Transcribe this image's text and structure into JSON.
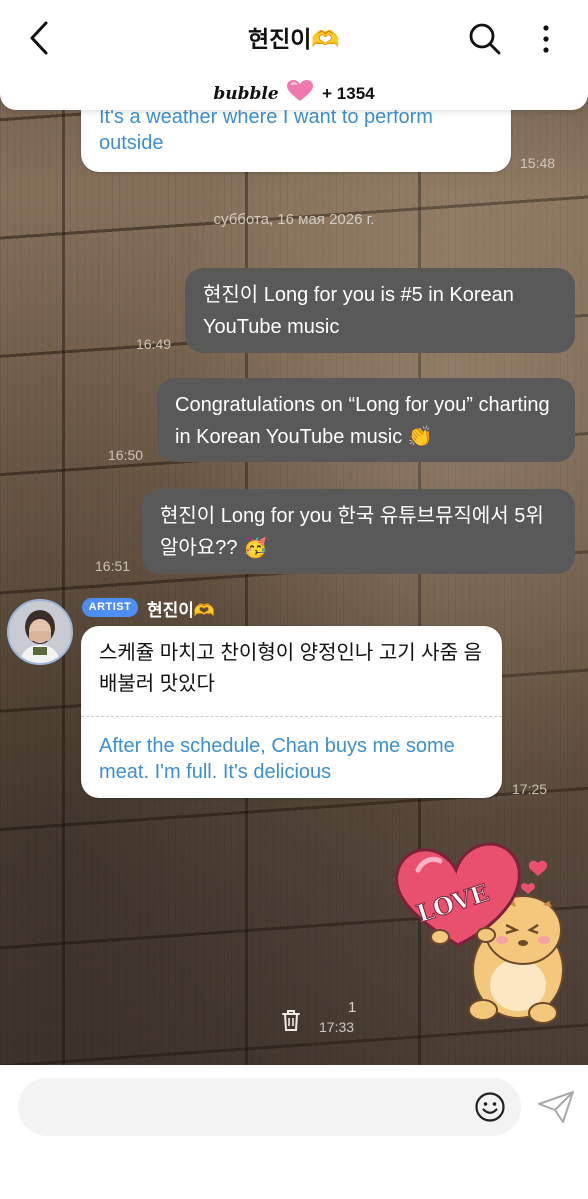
{
  "header": {
    "title": "현진이🫶",
    "bubble_brand": "bubble",
    "bubble_count": "+ 1354"
  },
  "messages": {
    "top_partial": {
      "text": "It's a weather where I want to perform outside",
      "time": "15:48"
    },
    "date_separator": "суббота, 16 мая 2026 г.",
    "out1": {
      "text": "현진이 Long for you is #5 in Korean YouTube music",
      "time": "16:49"
    },
    "out2": {
      "text": "Congratulations on “Long for you” charting in Korean YouTube music 👏",
      "time": "16:50"
    },
    "out3": {
      "text": "현진이 Long for you 한국 유튜브뮤직에서 5위 알아요?? 🥳",
      "time": "16:51"
    },
    "artist": {
      "badge": "ARTIST",
      "name": "현진이🫶",
      "korean": "스케쥴 마치고 찬이형이 양정인나 고기 사줌 음 배불러 맛있다",
      "translation": "After the schedule, Chan buys me some meat. I'm full. It's delicious",
      "time": "17:25"
    },
    "sticker": {
      "text": "LOVE",
      "read_count": "1",
      "time": "17:33"
    }
  },
  "input": {
    "placeholder": ""
  },
  "colors": {
    "outgoing_bubble": "#595959",
    "translation_text": "#3c8fd0",
    "artist_badge": "#4d8ef0",
    "heart_pink": "#f07ab0"
  },
  "icons": [
    "back-icon",
    "search-icon",
    "more-icon",
    "heart-icon",
    "avatar",
    "trash-icon",
    "emoji-icon",
    "send-icon"
  ]
}
